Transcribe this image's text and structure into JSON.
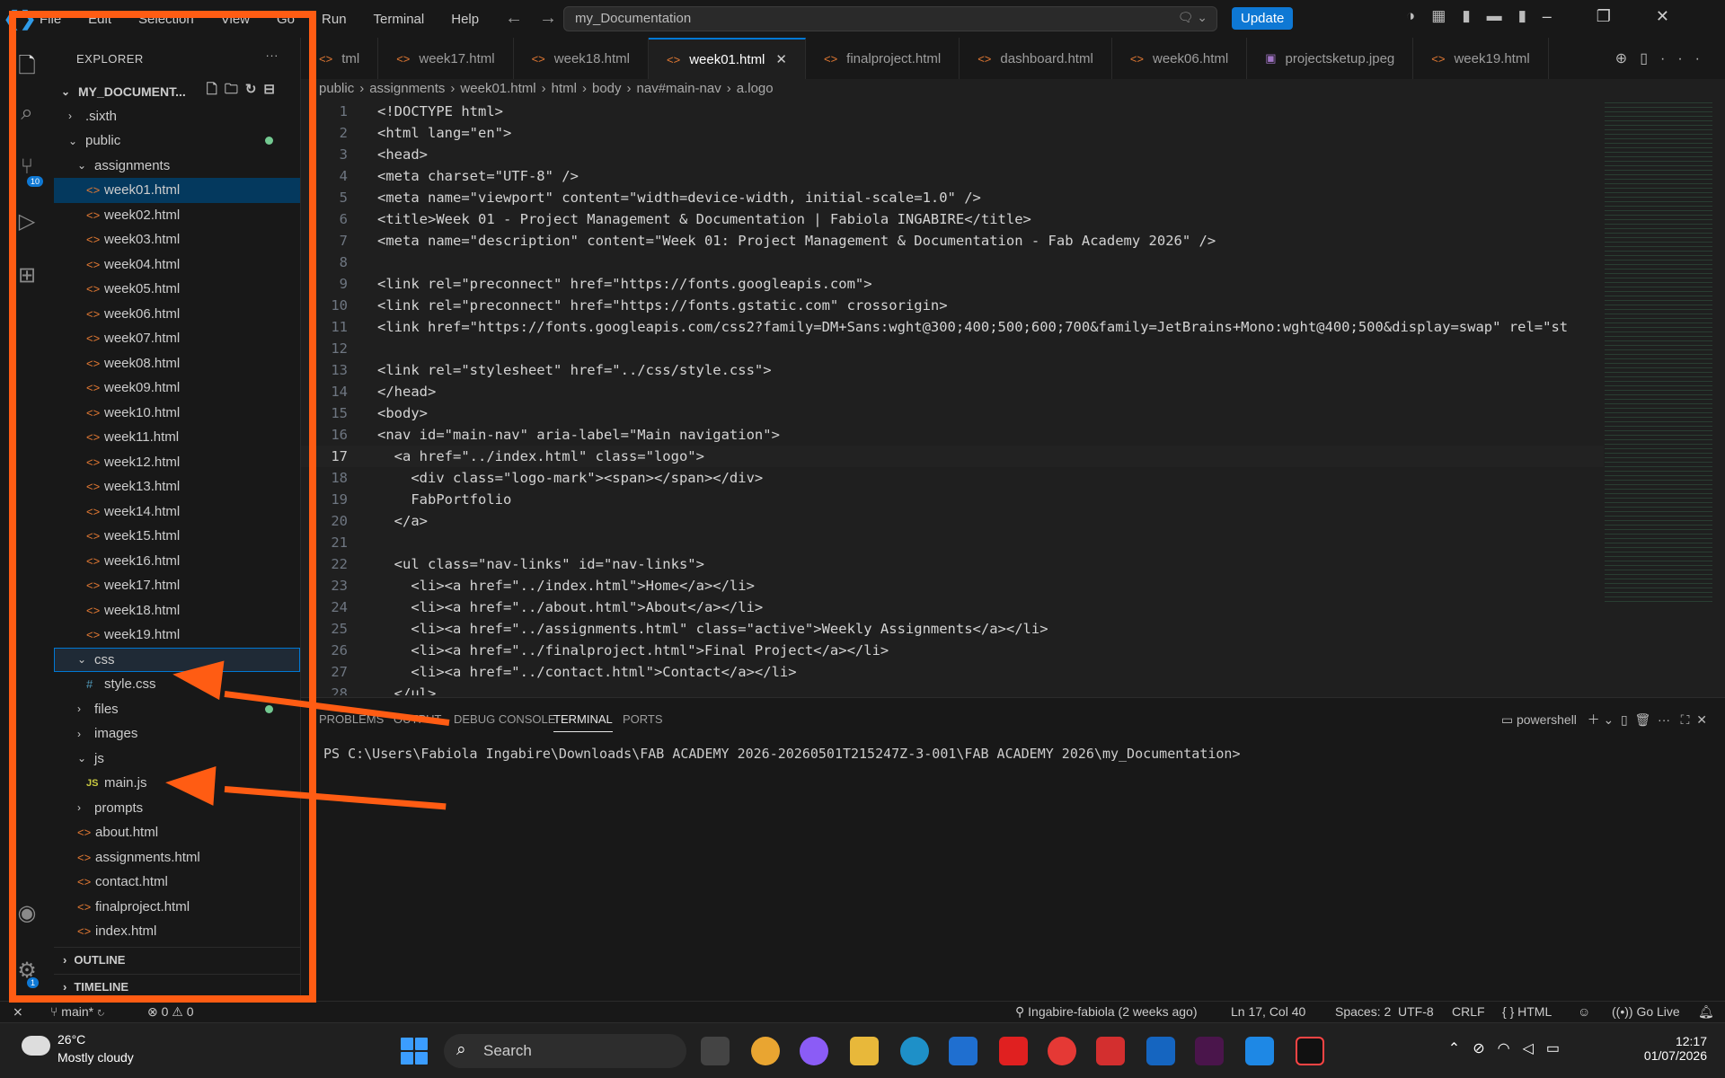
{
  "menu": [
    "File",
    "Edit",
    "Selection",
    "View",
    "Go",
    "Run",
    "Terminal",
    "Help"
  ],
  "search": {
    "project": "my_Documentation"
  },
  "update_label": "Update",
  "explorer": {
    "title": "EXPLORER",
    "project": "MY_DOCUMENT...",
    "items": [
      {
        "label": ".sixth",
        "type": "folder",
        "depth": 0,
        "open": false
      },
      {
        "label": "public",
        "type": "folder",
        "depth": 0,
        "open": true,
        "dot": true
      },
      {
        "label": "assignments",
        "type": "folder",
        "depth": 1,
        "open": true
      },
      {
        "label": "week01.html",
        "type": "html",
        "depth": 2,
        "selected": true
      },
      {
        "label": "week02.html",
        "type": "html",
        "depth": 2
      },
      {
        "label": "week03.html",
        "type": "html",
        "depth": 2
      },
      {
        "label": "week04.html",
        "type": "html",
        "depth": 2
      },
      {
        "label": "week05.html",
        "type": "html",
        "depth": 2
      },
      {
        "label": "week06.html",
        "type": "html",
        "depth": 2
      },
      {
        "label": "week07.html",
        "type": "html",
        "depth": 2
      },
      {
        "label": "week08.html",
        "type": "html",
        "depth": 2
      },
      {
        "label": "week09.html",
        "type": "html",
        "depth": 2
      },
      {
        "label": "week10.html",
        "type": "html",
        "depth": 2
      },
      {
        "label": "week11.html",
        "type": "html",
        "depth": 2
      },
      {
        "label": "week12.html",
        "type": "html",
        "depth": 2
      },
      {
        "label": "week13.html",
        "type": "html",
        "depth": 2
      },
      {
        "label": "week14.html",
        "type": "html",
        "depth": 2
      },
      {
        "label": "week15.html",
        "type": "html",
        "depth": 2
      },
      {
        "label": "week16.html",
        "type": "html",
        "depth": 2
      },
      {
        "label": "week17.html",
        "type": "html",
        "depth": 2
      },
      {
        "label": "week18.html",
        "type": "html",
        "depth": 2
      },
      {
        "label": "week19.html",
        "type": "html",
        "depth": 2
      },
      {
        "label": "css",
        "type": "folder",
        "depth": 1,
        "open": true,
        "focus": true
      },
      {
        "label": "style.css",
        "type": "css",
        "depth": 2
      },
      {
        "label": "files",
        "type": "folder",
        "depth": 1,
        "open": false,
        "dot": true
      },
      {
        "label": "images",
        "type": "folder",
        "depth": 1,
        "open": false
      },
      {
        "label": "js",
        "type": "folder",
        "depth": 1,
        "open": true
      },
      {
        "label": "main.js",
        "type": "js",
        "depth": 2
      },
      {
        "label": "prompts",
        "type": "folder",
        "depth": 1,
        "open": false
      },
      {
        "label": "about.html",
        "type": "html",
        "depth": 1
      },
      {
        "label": "assignments.html",
        "type": "html",
        "depth": 1
      },
      {
        "label": "contact.html",
        "type": "html",
        "depth": 1
      },
      {
        "label": "finalproject.html",
        "type": "html",
        "depth": 1
      },
      {
        "label": "index.html",
        "type": "html",
        "depth": 1
      }
    ],
    "outline": "OUTLINE",
    "timeline": "TIMELINE"
  },
  "tabs": [
    {
      "label": "tml",
      "type": "html"
    },
    {
      "label": "week17.html",
      "type": "html"
    },
    {
      "label": "week18.html",
      "type": "html"
    },
    {
      "label": "week01.html",
      "type": "html",
      "active": true
    },
    {
      "label": "finalproject.html",
      "type": "html"
    },
    {
      "label": "dashboard.html",
      "type": "html"
    },
    {
      "label": "week06.html",
      "type": "html"
    },
    {
      "label": "projectsketup.jpeg",
      "type": "img"
    },
    {
      "label": "week19.html",
      "type": "html"
    }
  ],
  "breadcrumbs": [
    "public",
    "assignments",
    "week01.html",
    "html",
    "body",
    "nav#main-nav",
    "a.logo"
  ],
  "code": [
    "<!DOCTYPE html>",
    "<html lang=\"en\">",
    "<head>",
    "<meta charset=\"UTF-8\" />",
    "<meta name=\"viewport\" content=\"width=device-width, initial-scale=1.0\" />",
    "<title>Week 01 - Project Management & Documentation | Fabiola INGABIRE</title>",
    "<meta name=\"description\" content=\"Week 01: Project Management & Documentation - Fab Academy 2026\" />",
    "",
    "<link rel=\"preconnect\" href=\"https://fonts.googleapis.com\">",
    "<link rel=\"preconnect\" href=\"https://fonts.gstatic.com\" crossorigin>",
    "<link href=\"https://fonts.googleapis.com/css2?family=DM+Sans:wght@300;400;500;600;700&family=JetBrains+Mono:wght@400;500&display=swap\" rel=\"st",
    "",
    "<link rel=\"stylesheet\" href=\"../css/style.css\">",
    "</head>",
    "<body>",
    "<nav id=\"main-nav\" aria-label=\"Main navigation\">",
    "  <a href=\"../index.html\" class=\"logo\">",
    "    <div class=\"logo-mark\"><span></span></div>",
    "    FabPortfolio",
    "  </a>",
    "",
    "  <ul class=\"nav-links\" id=\"nav-links\">",
    "    <li><a href=\"../index.html\">Home</a></li>",
    "    <li><a href=\"../about.html\">About</a></li>",
    "    <li><a href=\"../assignments.html\" class=\"active\">Weekly Assignments</a></li>",
    "    <li><a href=\"../finalproject.html\">Final Project</a></li>",
    "    <li><a href=\"../contact.html\">Contact</a></li>",
    "  </ul>"
  ],
  "current_line": 17,
  "panel": {
    "tabs": [
      "PROBLEMS",
      "OUTPUT",
      "DEBUG CONSOLE",
      "TERMINAL",
      "PORTS"
    ],
    "active": "TERMINAL",
    "shell": "powershell",
    "prompt": "PS C:\\Users\\Fabiola Ingabire\\Downloads\\FAB ACADEMY 2026-20260501T215247Z-3-001\\FAB ACADEMY 2026\\my_Documentation>"
  },
  "status": {
    "branch": "main*",
    "errors": "0",
    "warnings": "0",
    "blame": "Ingabire-fabiola (2 weeks ago)",
    "position": "Ln 17, Col 40",
    "spaces": "Spaces: 2",
    "encoding": "UTF-8",
    "eol": "CRLF",
    "language": "HTML",
    "golive": "Go Live"
  },
  "badges": {
    "scm": "10",
    "settings": "1"
  },
  "taskbar": {
    "temp": "26°C",
    "weather": "Mostly cloudy",
    "search": "Search",
    "time": "12:17",
    "date": "01/07/2026"
  },
  "colors": {
    "accent": "#0078d4",
    "annotation": "#ff5c13",
    "html_icon": "#e37933"
  }
}
